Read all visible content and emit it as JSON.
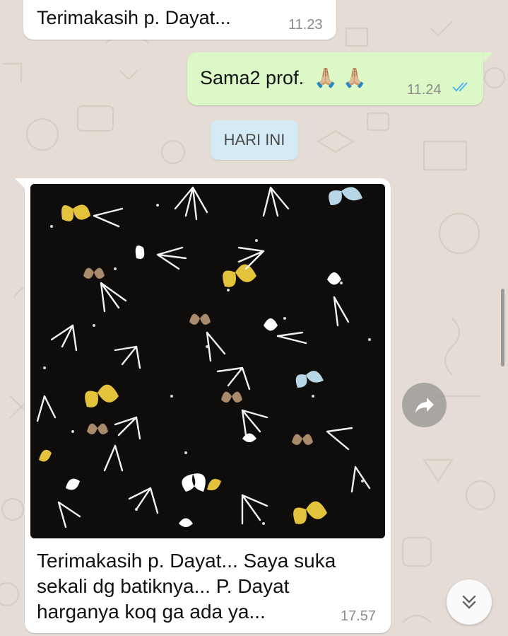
{
  "messages": [
    {
      "direction": "incoming",
      "text": "Terimakasih p.  Dayat...",
      "time": "11.23"
    },
    {
      "direction": "outgoing",
      "text": "Sama2 prof.",
      "emoji": "🙏🏼 🙏🏼",
      "time": "11.24",
      "status": "read"
    },
    {
      "direction": "incoming",
      "type": "image",
      "image_description_icon": "batik-photo",
      "caption": "Terimakasih p. Dayat...  Saya suka sekali dg batiknya... P. Dayat harganya koq ga ada ya...",
      "time": "17.57"
    }
  ],
  "date_chip": "HARI INI",
  "controls": {
    "forward_icon": "forward-arrow-icon",
    "scroll_icon": "double-chevron-down-icon"
  },
  "colors": {
    "outgoing_bubble": "#dcf8c6",
    "incoming_bubble": "#ffffff",
    "date_chip": "#d4eaf4",
    "read_ticks": "#4fb6ec",
    "background": "#e5ddd5"
  }
}
